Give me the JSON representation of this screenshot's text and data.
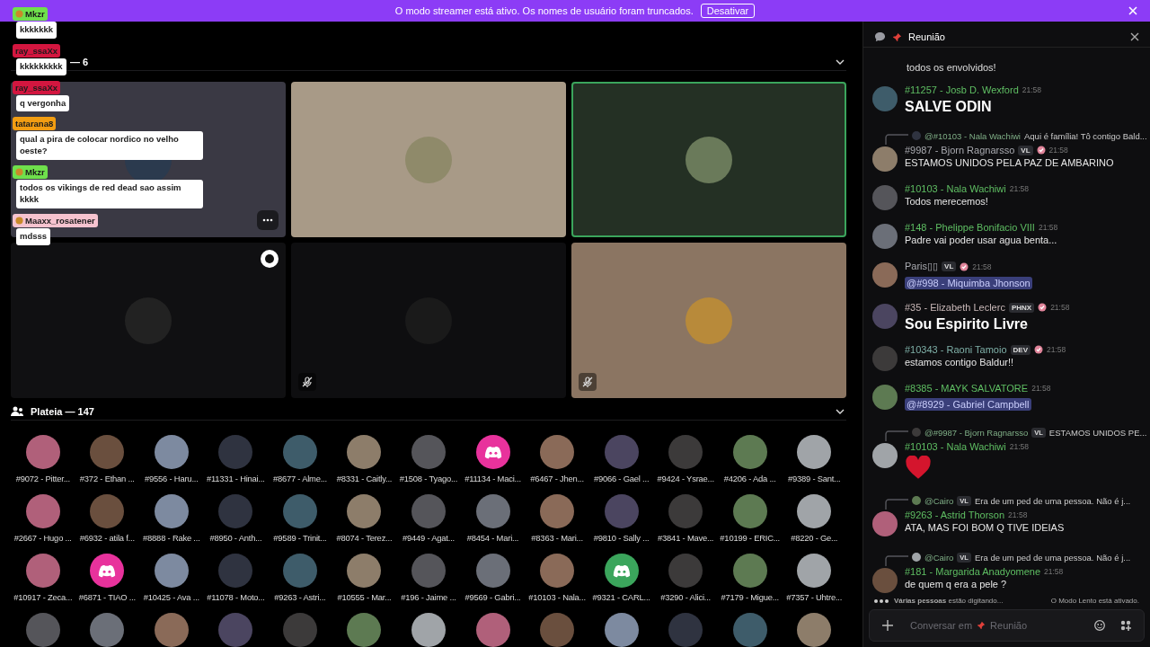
{
  "banner": {
    "text": "O modo streamer está ativo. Os nomes de usuário foram truncados.",
    "button": "Desativar"
  },
  "overlay_chat": [
    {
      "user": "Mkzr",
      "color": "#6fe04c",
      "icon": true,
      "text": "kkkkkkk"
    },
    {
      "user": "ray_ssaXx",
      "color": "#d3163f",
      "icon": false,
      "text": "kkkkkkkkk"
    },
    {
      "user": "ray_ssaXx",
      "color": "#d3163f",
      "icon": false,
      "text": "q vergonha"
    },
    {
      "user": "tatarana8",
      "color": "#f29d12",
      "icon": false,
      "text": "qual a pira de colocar nordico no velho oeste?"
    },
    {
      "user": "Mkzr",
      "color": "#6fe04c",
      "icon": true,
      "text": "todos os vikings de red dead sao assim kkkk"
    },
    {
      "user": "Maaxx_rosatener",
      "color": "#f6c3cf",
      "icon": true,
      "text": "mdsss"
    }
  ],
  "stage": {
    "title": "— 6",
    "expanded": true,
    "tiles": [
      {
        "speaking": false,
        "muted": false,
        "menu": true,
        "badge": false
      },
      {
        "speaking": false,
        "muted": false,
        "menu": false,
        "badge": false
      },
      {
        "speaking": true,
        "muted": false,
        "menu": false,
        "badge": false
      },
      {
        "speaking": false,
        "muted": false,
        "menu": false,
        "badge": true
      },
      {
        "speaking": false,
        "muted": true,
        "menu": false,
        "badge": false
      },
      {
        "speaking": false,
        "muted": true,
        "menu": false,
        "badge": false
      }
    ]
  },
  "audience": {
    "title": "Plateia — 147",
    "expanded": true,
    "members": [
      {
        "name": "#9072 - Pitter...",
        "kind": "photo"
      },
      {
        "name": "#372 - Ethan ...",
        "kind": "photo"
      },
      {
        "name": "#9556 - Haru...",
        "kind": "photo"
      },
      {
        "name": "#11331 - Hinai...",
        "kind": "photo"
      },
      {
        "name": "#8677 - Alme...",
        "kind": "photo"
      },
      {
        "name": "#8331 - Caitly...",
        "kind": "photo"
      },
      {
        "name": "#1508 - Tyago...",
        "kind": "photo"
      },
      {
        "name": "#11134 - Maci...",
        "kind": "logo",
        "color": "#e8329c"
      },
      {
        "name": "#6467 - Jhen...",
        "kind": "photo"
      },
      {
        "name": "#9066 - Gael ...",
        "kind": "photo"
      },
      {
        "name": "#9424 - Ysrae...",
        "kind": "photo"
      },
      {
        "name": "#4206 - Ada ...",
        "kind": "photo"
      },
      {
        "name": "#9389 - Sant...",
        "kind": "photo"
      },
      {
        "name": "#2667 - Hugo ...",
        "kind": "photo"
      },
      {
        "name": "#6932 - atila f...",
        "kind": "photo"
      },
      {
        "name": "#8888 - Rake ...",
        "kind": "photo"
      },
      {
        "name": "#8950 - Anth...",
        "kind": "photo"
      },
      {
        "name": "#9589 - Trinit...",
        "kind": "photo"
      },
      {
        "name": "#8074 - Terez...",
        "kind": "photo"
      },
      {
        "name": "#9449 - Agat...",
        "kind": "photo"
      },
      {
        "name": "#8454 - Mari...",
        "kind": "photo"
      },
      {
        "name": "#8363 - Mari...",
        "kind": "photo"
      },
      {
        "name": "#9810 - Sally ...",
        "kind": "photo"
      },
      {
        "name": "#3841 - Mave...",
        "kind": "photo"
      },
      {
        "name": "#10199 - ERIC...",
        "kind": "photo"
      },
      {
        "name": "#8220 - Ge...",
        "kind": "photo"
      },
      {
        "name": "#10917 - Zeca...",
        "kind": "photo"
      },
      {
        "name": "#6871 - TIAO ...",
        "kind": "logo",
        "color": "#e8329c"
      },
      {
        "name": "#10425 - Ava ...",
        "kind": "photo"
      },
      {
        "name": "#11078 - Moto...",
        "kind": "photo"
      },
      {
        "name": "#9263 - Astri...",
        "kind": "photo"
      },
      {
        "name": "#10555 - Mar...",
        "kind": "photo"
      },
      {
        "name": "#196 - Jaime ...",
        "kind": "photo"
      },
      {
        "name": "#9569 - Gabri...",
        "kind": "photo"
      },
      {
        "name": "#10103 - Nala...",
        "kind": "photo"
      },
      {
        "name": "#9321 - CARL...",
        "kind": "logo",
        "color": "#3ba55c"
      },
      {
        "name": "#3290 - Alici...",
        "kind": "photo"
      },
      {
        "name": "#7179 - Migue...",
        "kind": "photo"
      },
      {
        "name": "#7357 - Uhtre...",
        "kind": "photo"
      }
    ]
  },
  "chat": {
    "channel": "Reunião",
    "lead_text": "todos os envolvidos!",
    "messages": [
      {
        "author": "#11257 - Josb D. Wexford",
        "color": "#5fbf63",
        "time": "21:58",
        "text": "SALVE ODIN",
        "kind": "jumbo"
      },
      {
        "reply": {
          "author": "@#10103 - Nala Wachiwi",
          "text": "Aqui é família! Tô contigo Bald..."
        },
        "author": "#9987 - Bjorn Ragnarsso",
        "color": "#a9aab0",
        "tag": "VL",
        "time": "21:58",
        "text": "ESTAMOS UNIDOS PELA PAZ DE AMBARINO",
        "kind": "text"
      },
      {
        "author": "#10103 - Nala Wachiwi",
        "color": "#5fbf63",
        "time": "21:58",
        "text": "Todos merecemos!",
        "kind": "text"
      },
      {
        "author": "#148 - Phelippe Bonifacio VIII",
        "color": "#5fbf63",
        "time": "21:58",
        "text": "Padre vai poder usar agua benta...",
        "kind": "text"
      },
      {
        "author": "Paris▯▯",
        "color": "#a9aab0",
        "tag": "VL",
        "time": "21:58",
        "text": "@#998 - Miquimba Jhonson",
        "kind": "mention"
      },
      {
        "author": "#35 - Elizabeth Leclerc",
        "color": "#c9b8b8",
        "tag": "PHNX",
        "time": "21:58",
        "text": "Sou Espirito Livre",
        "kind": "jumbo"
      },
      {
        "author": "#10343 - Raoni Tamoio",
        "color": "#7fb0a8",
        "tag": "DEV",
        "time": "21:58",
        "text": "estamos contigo Baldur!!",
        "kind": "text"
      },
      {
        "author": "#8385 - MAYK SALVATORE",
        "color": "#5fbf63",
        "time": "21:58",
        "text": "@#8929 - Gabriel Campbell",
        "kind": "mention"
      },
      {
        "reply": {
          "author": "@#9987 - Bjorn Ragnarsso",
          "tag": "VL",
          "text": "ESTAMOS UNIDOS PE..."
        },
        "author": "#10103 - Nala Wachiwi",
        "color": "#5fbf63",
        "time": "21:58",
        "kind": "heart"
      },
      {
        "reply": {
          "author": "@Cairo",
          "tag": "VL",
          "text": "Era de um ped de uma pessoa. Não é j..."
        },
        "author": "#9263 - Astrid Thorson",
        "color": "#5fbf63",
        "time": "21:58",
        "text": "ATA, MAS FOI BOM Q TIVE IDEIAS",
        "kind": "text"
      },
      {
        "reply": {
          "author": "@Cairo",
          "tag": "VL",
          "text": "Era de um ped de uma pessoa. Não é j..."
        },
        "author": "#181 - Margarida Anadyomene",
        "color": "#5fbf63",
        "time": "21:58",
        "text": "de quem q era a pele ?",
        "kind": "text"
      }
    ],
    "typing": "**Várias pessoas** estão digitando...",
    "slowmode": "O Modo Lento está ativado.",
    "input_prefix": "Conversar em",
    "input_channel": "Reunião"
  }
}
